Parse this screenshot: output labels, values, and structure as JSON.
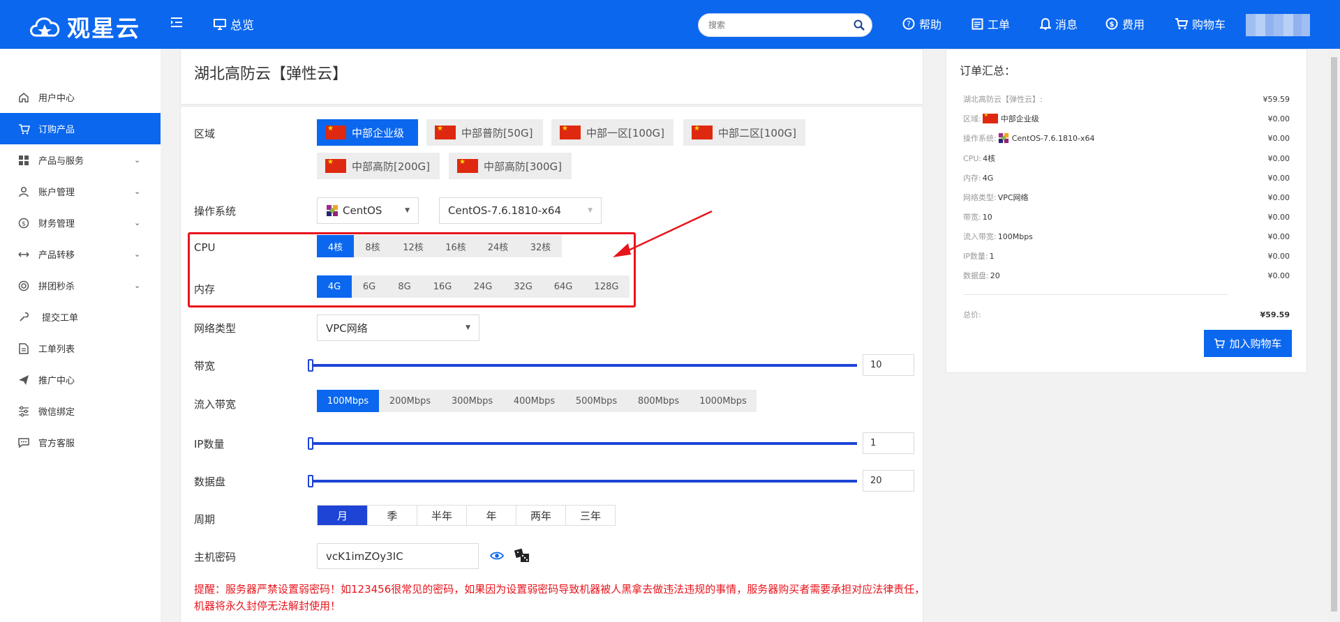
{
  "header": {
    "logo_text": "观星云",
    "overview": "总览",
    "search_placeholder": "搜索",
    "nav": [
      "帮助",
      "工单",
      "消息",
      "费用",
      "购物车"
    ]
  },
  "sidebar": {
    "items": [
      {
        "label": "用户中心",
        "icon": "home-icon",
        "chevron": false
      },
      {
        "label": "订购产品",
        "icon": "cart-icon",
        "chevron": false,
        "active": true
      },
      {
        "label": "产品与服务",
        "icon": "grid-icon",
        "chevron": true
      },
      {
        "label": "账户管理",
        "icon": "user-icon",
        "chevron": true
      },
      {
        "label": "财务管理",
        "icon": "dollar-icon",
        "chevron": true
      },
      {
        "label": "产品转移",
        "icon": "transfer-icon",
        "chevron": true
      },
      {
        "label": "拼团秒杀",
        "icon": "target-icon",
        "chevron": true
      },
      {
        "label": "提交工单",
        "icon": "wrench-icon",
        "chevron": false
      },
      {
        "label": "工单列表",
        "icon": "document-icon",
        "chevron": false
      },
      {
        "label": "推广中心",
        "icon": "send-icon",
        "chevron": false
      },
      {
        "label": "微信绑定",
        "icon": "sliders-icon",
        "chevron": false
      },
      {
        "label": "官方客服",
        "icon": "chat-icon",
        "chevron": false
      }
    ]
  },
  "product": {
    "title": "湖北高防云【弹性云】",
    "labels": {
      "region": "区域",
      "os": "操作系统",
      "cpu": "CPU",
      "memory": "内存",
      "network": "网络类型",
      "bandwidth": "带宽",
      "inbound": "流入带宽",
      "ip": "IP数量",
      "disk": "数据盘",
      "period": "周期",
      "password": "主机密码"
    },
    "regions": [
      "中部企业级",
      "中部普防[50G]",
      "中部一区[100G]",
      "中部二区[100G]",
      "中部高防[200G]",
      "中部高防[300G]"
    ],
    "os_family": "CentOS",
    "os_version": "CentOS-7.6.1810-x64",
    "cpu_options": [
      "4核",
      "8核",
      "12核",
      "16核",
      "24核",
      "32核"
    ],
    "memory_options": [
      "4G",
      "6G",
      "8G",
      "16G",
      "24G",
      "32G",
      "64G",
      "128G"
    ],
    "network_type": "VPC网络",
    "bandwidth_value": "10",
    "inbound_options": [
      "100Mbps",
      "200Mbps",
      "300Mbps",
      "400Mbps",
      "500Mbps",
      "800Mbps",
      "1000Mbps"
    ],
    "ip_value": "1",
    "disk_value": "20",
    "period_options": [
      "月",
      "季",
      "半年",
      "年",
      "两年",
      "三年"
    ],
    "password": "vcK1imZOy3IC",
    "warning": "提醒：服务器严禁设置弱密码！如123456很常见的密码，如果因为设置弱密码导致机器被人黑拿去做违法违规的事情，服务器购买者需要承担对应法律责任，机器将永久封停无法解封使用！"
  },
  "summary": {
    "title": "订单汇总：",
    "rows": [
      {
        "k": "湖北高防云【弹性云】:",
        "v": "",
        "price": "¥59.59"
      },
      {
        "k": "区域:",
        "v": "中部企业级",
        "flag": true,
        "price": "¥0.00"
      },
      {
        "k": "操作系统:",
        "v": "CentOS-7.6.1810-x64",
        "os_icon": true,
        "price": "¥0.00"
      },
      {
        "k": "CPU:",
        "v": "4核",
        "price": "¥0.00"
      },
      {
        "k": "内存:",
        "v": "4G",
        "price": "¥0.00"
      },
      {
        "k": "网络类型:",
        "v": "VPC网络",
        "price": "¥0.00"
      },
      {
        "k": "带宽:",
        "v": "10",
        "price": "¥0.00"
      },
      {
        "k": "流入带宽:",
        "v": "100Mbps",
        "price": "¥0.00"
      },
      {
        "k": "IP数量:",
        "v": "1",
        "price": "¥0.00"
      },
      {
        "k": "数据盘:",
        "v": "20",
        "price": "¥0.00"
      }
    ],
    "total_label": "总价:",
    "total_price": "¥59.59",
    "cart_button": "加入购物车"
  },
  "colors": {
    "brand": "#0b67ee",
    "warning": "#e8141c",
    "slider": "#1e44d6"
  }
}
